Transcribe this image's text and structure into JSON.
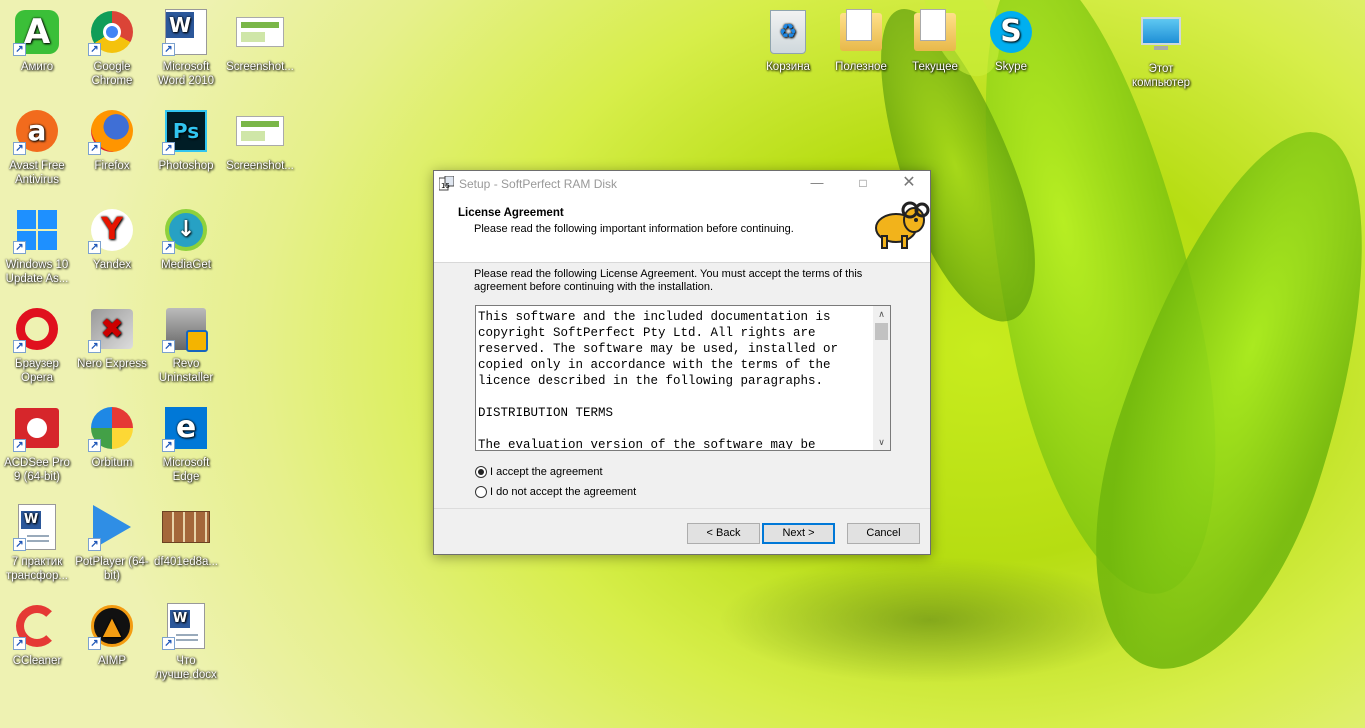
{
  "desktop": {
    "icons": [
      {
        "label": "Амиго",
        "icon": "amigo-icon"
      },
      {
        "label": "Google Chrome",
        "icon": "chrome-icon"
      },
      {
        "label": "Microsoft Word 2010",
        "icon": "word-icon"
      },
      {
        "label": "Screenshot...",
        "icon": "screenshot-icon"
      },
      {
        "label": "Avast Free Antivirus",
        "icon": "avast-icon"
      },
      {
        "label": "Firefox",
        "icon": "firefox-icon"
      },
      {
        "label": "Photoshop",
        "icon": "photoshop-icon"
      },
      {
        "label": "Screenshot...",
        "icon": "screenshot-icon"
      },
      {
        "label": "Windows 10 Update As...",
        "icon": "windows-update-icon"
      },
      {
        "label": "Yandex",
        "icon": "yandex-icon"
      },
      {
        "label": "MediaGet",
        "icon": "mediaget-icon"
      },
      {
        "label": "Браузер Opera",
        "icon": "opera-icon"
      },
      {
        "label": "Nero Express",
        "icon": "nero-icon"
      },
      {
        "label": "Revo Uninstaller",
        "icon": "revo-icon"
      },
      {
        "label": "ACDSee Pro 9 (64-bit)",
        "icon": "acdsee-icon"
      },
      {
        "label": "Orbitum",
        "icon": "orbitum-icon"
      },
      {
        "label": "Microsoft Edge",
        "icon": "edge-icon"
      },
      {
        "label": "7 практик трансфор...",
        "icon": "word-doc-icon"
      },
      {
        "label": "PotPlayer (64-bit)",
        "icon": "potplayer-icon"
      },
      {
        "label": "df401ed8a...",
        "icon": "image-file-icon"
      },
      {
        "label": "CCleaner",
        "icon": "ccleaner-icon"
      },
      {
        "label": "AIMP",
        "icon": "aimp-icon"
      },
      {
        "label": "Что лучше.docx",
        "icon": "word-doc-icon"
      },
      {
        "label": "Корзина",
        "icon": "recycle-bin-icon"
      },
      {
        "label": "Полезное",
        "icon": "folder-icon"
      },
      {
        "label": "Текущее",
        "icon": "folder-icon"
      },
      {
        "label": "Skype",
        "icon": "skype-icon"
      },
      {
        "label": "Этот компьютер",
        "icon": "this-pc-icon"
      }
    ]
  },
  "dialog": {
    "title": "Setup - SoftPerfect RAM Disk",
    "header_title": "License Agreement",
    "header_subtitle": "Please read the following important information before continuing.",
    "instructions": "Please read the following License Agreement. You must accept the terms of this agreement before continuing with the installation.",
    "license_text": "This software and the included documentation is copyright SoftPerfect Pty Ltd. All rights are reserved. The software may be used, installed or copied only in accordance with the terms of the licence described in the following paragraphs.\n\nDISTRIBUTION TERMS\n\nThe evaluation version of the software may be",
    "radio_accept": "I accept the agreement",
    "radio_decline": "I do not accept the agreement",
    "accept_selected": true,
    "btn_back": "< Back",
    "btn_next": "Next >",
    "btn_cancel": "Cancel"
  }
}
